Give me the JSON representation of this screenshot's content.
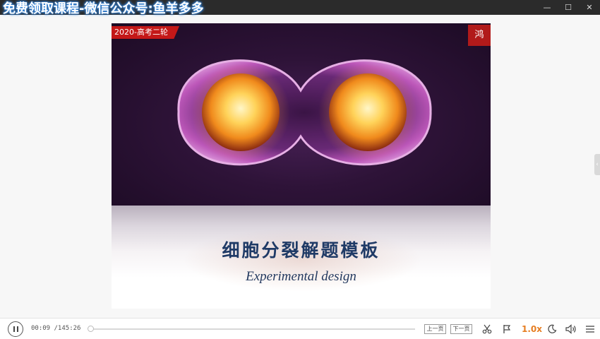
{
  "watermark": "免费领取课程-微信公众号:鱼羊多多",
  "window": {
    "minimize": "—",
    "maximize": "☐",
    "close": "✕"
  },
  "slide": {
    "tag": "2020-高考二轮",
    "seal": "鸿",
    "title": "细胞分裂解题模板",
    "subtitle": "Experimental design"
  },
  "player": {
    "current_time": "00:09",
    "total_time": "/145:26",
    "progress": 0.001,
    "prev_page": "上一页",
    "next_page": "下一页",
    "speed": "1.0x",
    "accent_color": "#e67e22"
  }
}
